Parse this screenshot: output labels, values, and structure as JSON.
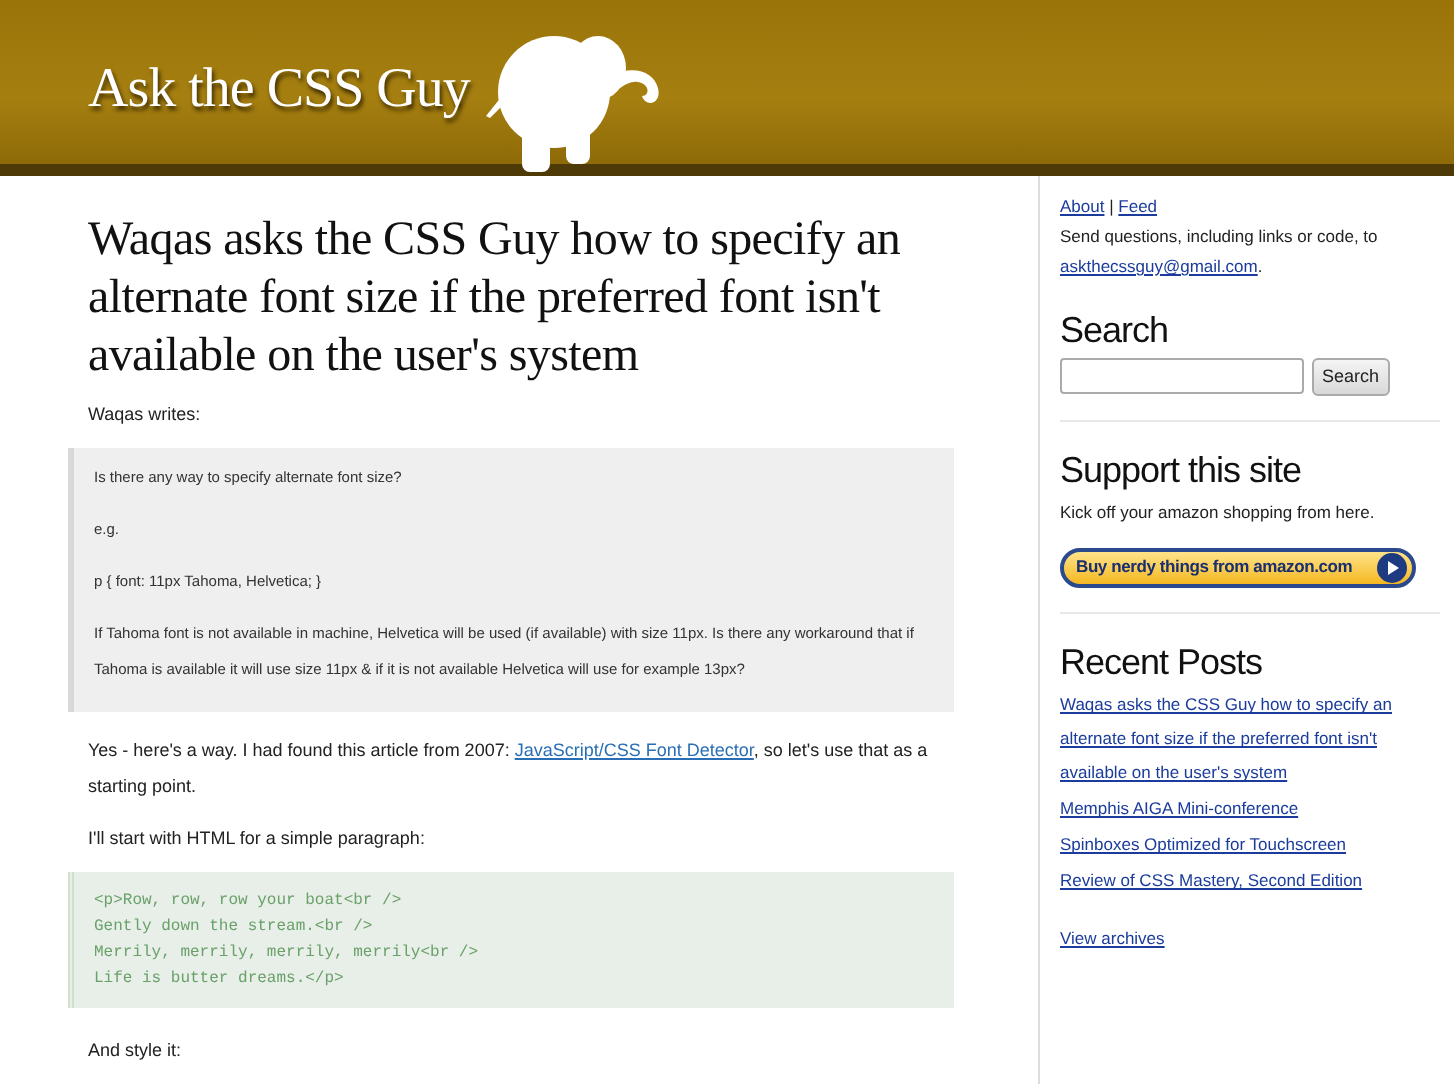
{
  "header": {
    "logo": "Ask the CSS Guy"
  },
  "post": {
    "title": "Waqas asks the CSS Guy how to specify an alternate font size if the preferred font isn't available on the user's system",
    "blocks": [
      {
        "kind": "text",
        "parts": [
          {
            "text": "Waqas writes:",
            "link": false
          }
        ]
      },
      {
        "kind": "quote",
        "lines": [
          "Is there any way to specify alternate font size?",
          "e.g.",
          "p { font: 11px Tahoma, Helvetica; }",
          "If Tahoma font is not available in machine, Helvetica will be used (if available) with size 11px. Is there any workaround that if Tahoma is available it will use size 11px & if it is not available Helvetica will use for example 13px?"
        ]
      },
      {
        "kind": "text",
        "parts": [
          {
            "text": "Yes - here's a way. I had found this article from 2007: ",
            "link": false
          },
          {
            "text": "JavaScript/CSS Font Detector",
            "link": true
          },
          {
            "text": ", so let's use that as a starting point.",
            "link": false
          }
        ]
      },
      {
        "kind": "text",
        "parts": [
          {
            "text": "I'll start with HTML for a simple paragraph:",
            "link": false
          }
        ]
      },
      {
        "kind": "code",
        "lines": [
          "<p>Row, row, row your boat<br />",
          "Gently down the stream.<br />",
          "Merrily, merrily, merrily, merrily<br />",
          "Life is butter dreams.</p>"
        ]
      },
      {
        "kind": "text",
        "parts": [
          {
            "text": "And style it:",
            "link": false
          }
        ]
      }
    ]
  },
  "sidebar": {
    "links": [
      "About",
      "Feed"
    ],
    "link_separator": "|",
    "send_text": "Send questions, including links or code, to",
    "email": "askthecssguy@gmail.com",
    "email_after": ".",
    "search": {
      "heading": "Search",
      "button": "Search"
    },
    "support": {
      "heading": "Support this site",
      "text": "Kick off your amazon shopping from here.",
      "button": "Buy nerdy things from amazon.com"
    },
    "recent": {
      "heading": "Recent Posts",
      "posts": [
        "Waqas asks the CSS Guy how to specify an alternate font size if the preferred font isn't available on the user's system",
        "Memphis AIGA Mini-conference",
        "Spinboxes Optimized for Touchscreen",
        "Review of CSS Mastery, Second Edition"
      ],
      "archives": "View archives"
    }
  }
}
